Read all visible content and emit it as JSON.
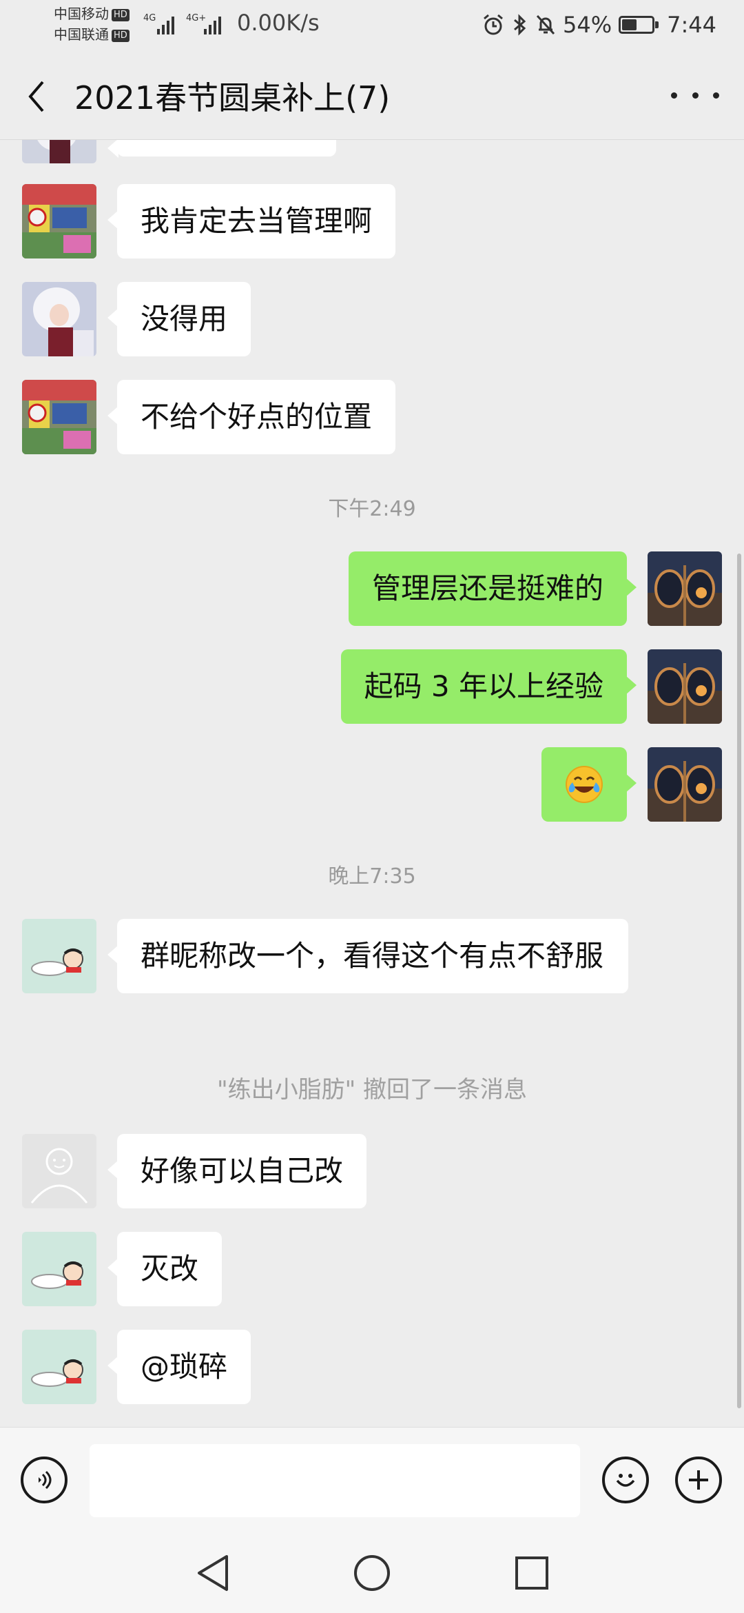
{
  "status_bar": {
    "carrier1": "中国移动",
    "carrier2": "中国联通",
    "hd1": "HD",
    "hd2": "HD",
    "net1": "4G",
    "net2": "4G+",
    "net_speed": "0.00K/s",
    "battery_percent": "54%",
    "battery_level": 0.54,
    "time": "7:44"
  },
  "header": {
    "title": "2021春节圆桌补上(7)"
  },
  "messages": [
    {
      "text": "我肯定去当管理啊"
    },
    {
      "text": "没得用"
    },
    {
      "text": "不给个好点的位置"
    },
    {
      "time": "下午2:49"
    },
    {
      "text": "管理层还是挺难的"
    },
    {
      "text": "起码 3 年以上经验"
    },
    {
      "emoji": "😂"
    },
    {
      "time": "晚上7:35"
    },
    {
      "text": "群昵称改一个，看得这个有点不舒服"
    },
    {
      "system": "\"练出小脂肪\" 撤回了一条消息"
    },
    {
      "text": "好像可以自己改"
    },
    {
      "text": "灭改"
    },
    {
      "text": "@琐碎"
    }
  ],
  "colors": {
    "background": "#ededed",
    "bubble_self": "#95ec69",
    "bubble_other": "#ffffff"
  },
  "icons": {
    "voice": "voice-icon",
    "emoji": "emoji-icon",
    "plus": "plus-icon",
    "back": "back-arrow-icon",
    "more": "more-icon"
  }
}
